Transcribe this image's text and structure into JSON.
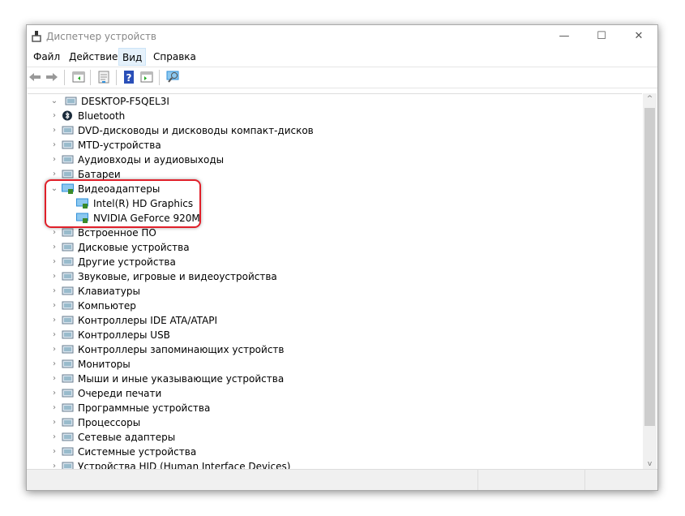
{
  "window": {
    "title": "Диспетчер устройств",
    "minimize": "—",
    "maximize": "☐",
    "close": "✕"
  },
  "menu": [
    "Файл",
    "Действие",
    "Вид",
    "Справка"
  ],
  "menu_active": "Вид",
  "toolbar": [
    {
      "icon": "back-icon"
    },
    {
      "icon": "forward-icon"
    },
    {
      "icon": "show-hide-console-tree-icon"
    },
    {
      "icon": "properties-icon"
    },
    {
      "icon": "help-icon"
    },
    {
      "icon": "action-pane-icon"
    },
    {
      "icon": "scan-hardware-icon"
    }
  ],
  "tree": {
    "root": "DESKTOP-F5QEL3I",
    "items": [
      {
        "label": "Bluetooth",
        "icon": "bluetooth-icon"
      },
      {
        "label": "DVD-дисководы и дисководы компакт-дисков",
        "icon": "dvd-icon"
      },
      {
        "label": "MTD-устройства",
        "icon": "mtd-icon"
      },
      {
        "label": "Аудиовходы и аудиовыходы",
        "icon": "audio-icon"
      },
      {
        "label": "Батареи",
        "icon": "battery-icon"
      },
      {
        "label": "Видеоадаптеры",
        "icon": "display-adapter-icon",
        "expanded": true,
        "children": [
          "Intel(R) HD Graphics",
          "NVIDIA GeForce 920M"
        ]
      },
      {
        "label": "Встроенное ПО",
        "icon": "firmware-icon"
      },
      {
        "label": "Дисковые устройства",
        "icon": "disk-icon"
      },
      {
        "label": "Другие устройства",
        "icon": "other-devices-icon"
      },
      {
        "label": "Звуковые, игровые и видеоустройства",
        "icon": "sound-icon"
      },
      {
        "label": "Клавиатуры",
        "icon": "keyboard-icon"
      },
      {
        "label": "Компьютер",
        "icon": "computer-icon"
      },
      {
        "label": "Контроллеры IDE ATA/ATAPI",
        "icon": "ide-icon"
      },
      {
        "label": "Контроллеры USB",
        "icon": "usb-icon"
      },
      {
        "label": "Контроллеры запоминающих устройств",
        "icon": "storage-icon"
      },
      {
        "label": "Мониторы",
        "icon": "monitor-icon"
      },
      {
        "label": "Мыши и иные указывающие устройства",
        "icon": "mouse-icon"
      },
      {
        "label": "Очереди печати",
        "icon": "printer-icon"
      },
      {
        "label": "Программные устройства",
        "icon": "software-device-icon"
      },
      {
        "label": "Процессоры",
        "icon": "cpu-icon"
      },
      {
        "label": "Сетевые адаптеры",
        "icon": "network-icon"
      },
      {
        "label": "Системные устройства",
        "icon": "system-icon"
      },
      {
        "label": "Устройства HID (Human Interface Devices)",
        "icon": "hid-icon"
      }
    ]
  },
  "colors": {
    "highlight": "#e0202a",
    "menu_active": "#e5f1fb",
    "icon_blue": "#2f8fd8"
  }
}
